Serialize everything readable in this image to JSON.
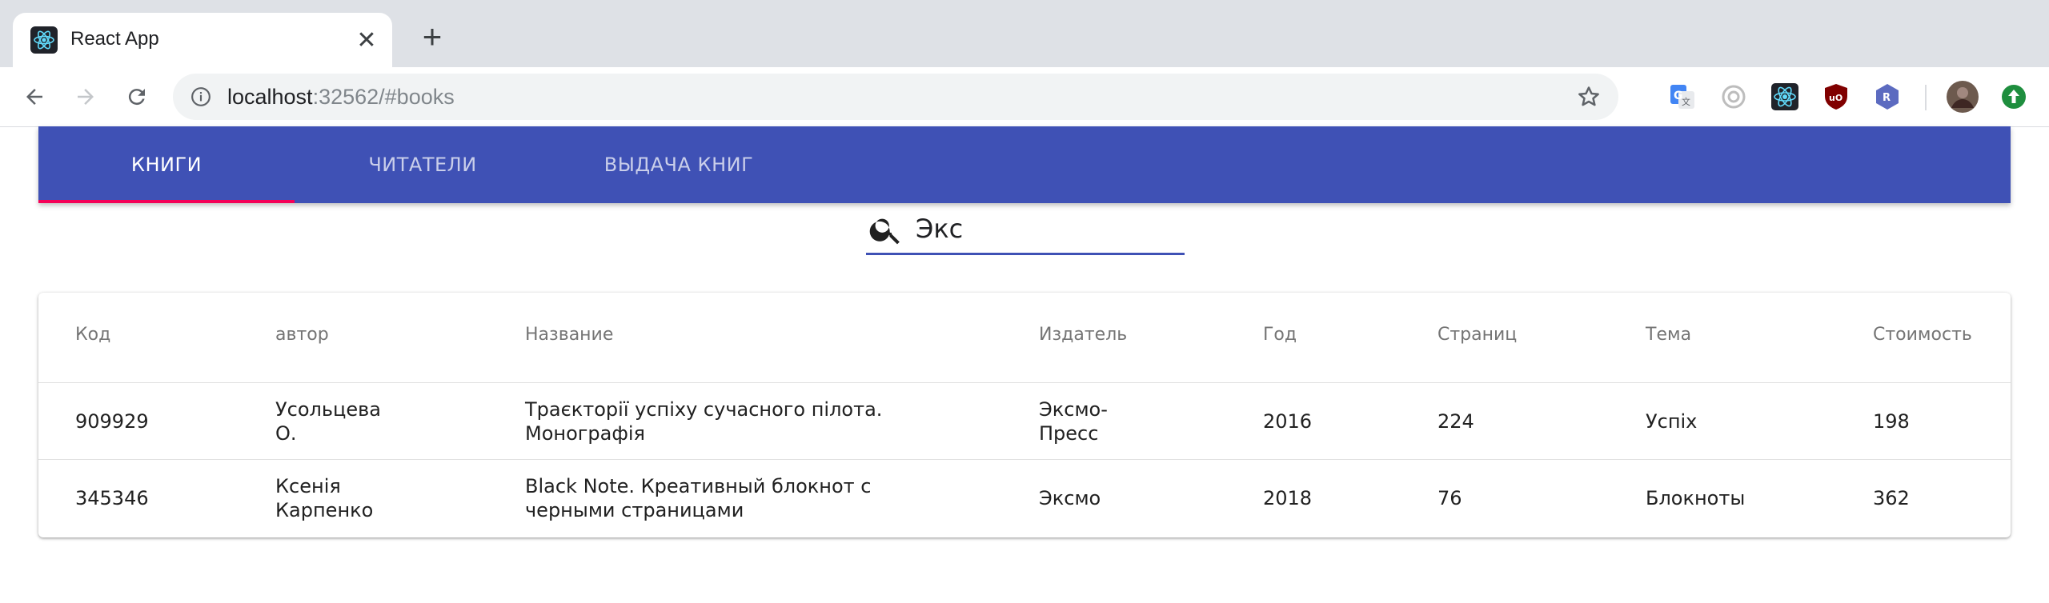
{
  "browser": {
    "tab_title": "React App",
    "url_host": "localhost",
    "url_rest": ":32562/#books"
  },
  "app": {
    "nav_tabs": [
      {
        "label": "Книги",
        "active": true
      },
      {
        "label": "Читатели",
        "active": false
      },
      {
        "label": "Выдача книг",
        "active": false
      }
    ],
    "search": {
      "value": "Экс",
      "icon": "search-icon"
    },
    "table": {
      "headers": {
        "code": "Код",
        "author": "автор",
        "title": "Название",
        "publisher": "Издатель",
        "year": "Год",
        "pages": "Страниц",
        "theme": "Тема",
        "price": "Стоимость"
      },
      "rows": [
        {
          "code": "909929",
          "author_line1": "Усольцева",
          "author_line2": "О.",
          "title_line1": "Траєкторії успіху сучасного пілота.",
          "title_line2": "Монографія",
          "publisher_line1": "Эксмо-",
          "publisher_line2": "Пресс",
          "year": "2016",
          "pages": "224",
          "theme": "Успіх",
          "price": "198"
        },
        {
          "code": "345346",
          "author_line1": "Ксенія",
          "author_line2": "Карпенко",
          "title_line1": "Black Note. Креативный блокнот с",
          "title_line2": "черными страницами",
          "publisher": "Эксмо",
          "year": "2018",
          "pages": "76",
          "theme": "Блокноты",
          "price": "362"
        }
      ]
    }
  },
  "colors": {
    "appbar": "#3f51b5",
    "indicator": "#f50057",
    "tabstrip": "#dee1e6"
  }
}
